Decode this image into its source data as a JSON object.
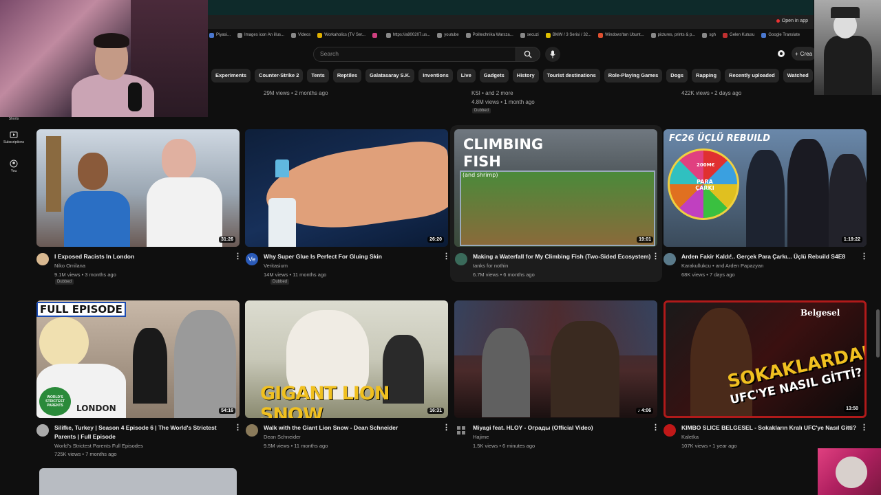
{
  "browser": {
    "open_in_app": "Open in app"
  },
  "bookmarks": [
    {
      "label": "Piyasi...",
      "color": "#4a78d0"
    },
    {
      "label": "Images icon An illus...",
      "color": "#888"
    },
    {
      "label": "Videos",
      "color": "#888"
    },
    {
      "label": "Workaholics (TV Ser...",
      "color": "#e0b000"
    },
    {
      "label": "",
      "color": "#d04080"
    },
    {
      "label": "https://a800207.us...",
      "color": "#888"
    },
    {
      "label": "youtube",
      "color": "#888"
    },
    {
      "label": "Politechnika Warsza...",
      "color": "#888"
    },
    {
      "label": "secuzi",
      "color": "#888"
    },
    {
      "label": "BMW / 3 Serisi / 32...",
      "color": "#e0c000"
    },
    {
      "label": "Windows'tan Ubunt...",
      "color": "#e05030"
    },
    {
      "label": "pictures, prints & p...",
      "color": "#888"
    },
    {
      "label": "sgh",
      "color": "#888"
    },
    {
      "label": "Gelen Kutusu",
      "color": "#c03030"
    },
    {
      "label": "Google Translate",
      "color": "#4a78d0"
    }
  ],
  "search": {
    "placeholder": "Search"
  },
  "header": {
    "create_label": "Crea"
  },
  "chips": [
    "Experiments",
    "Counter-Strike 2",
    "Tents",
    "Reptiles",
    "Galatasaray S.K.",
    "Inventions",
    "Live",
    "Gadgets",
    "History",
    "Tourist destinations",
    "Role-Playing Games",
    "Dogs",
    "Rapping",
    "Recently uploaded",
    "Watched"
  ],
  "sidebar": {
    "shorts_label": "Shorts",
    "subscriptions_label": "Subscriptions",
    "you_label": "You"
  },
  "row0": [
    {
      "meta": "29M views • 2 months ago"
    },
    {
      "meta": "KSI • and 2 more",
      "meta2": "4.8M views • 1 month ago",
      "badge": "Dubbed"
    },
    {
      "meta": "422K views • 2 days ago"
    }
  ],
  "videos": [
    {
      "title": "I Exposed Racists In London",
      "channel": "Niko Omilana",
      "stats": "9.1M views • 3 months ago",
      "duration": "31:26",
      "badge": "Dubbed"
    },
    {
      "title": "Why Super Glue Is Perfect For Gluing Skin",
      "channel": "Veritasium",
      "stats": "14M views • 11 months ago",
      "duration": "26:20",
      "badge": "Dubbed",
      "avatar_text": "Ve"
    },
    {
      "title": "Making a Waterfall for My Climbing Fish (Two-Sided Ecosystem)",
      "channel": "tanks for nothin",
      "stats": "6.7M views • 6 months ago",
      "duration": "19:01",
      "overlay1": "CLIMBING",
      "overlay2": "FISH",
      "overlay3": "(and shrimp)"
    },
    {
      "title": "Arden Fakir Kaldı!.. Gerçek Para Çarkı... Üçlü Rebuild S4E8",
      "channel": "Karakullukcu • and Arden Papazyan",
      "stats": "68K views • 7 days ago",
      "duration": "1:19:22",
      "overlay1": "FC26 ÜÇLÜ REBUILD",
      "wheel_center": "PARA ÇARKI",
      "wheel_label": "200M€"
    },
    {
      "title": "Silifke, Turkey | Season 4 Episode 6 | The World's Strictest",
      "title2": "Parents | Full Episode",
      "channel": "World's Strictest Parents Full Episodes",
      "stats": "725K views • 7 months ago",
      "duration": "54:16",
      "overlay1": "FULL EPISODE",
      "overlay2": "WORLD'S STRICTEST PARENTS",
      "shirt": "LONDON"
    },
    {
      "title": "Walk with the Giant Lion Snow - Dean Schneider",
      "channel": "Dean Schneider",
      "stats": "9.5M views • 11 months ago",
      "duration": "16:31",
      "overlay1": "GIGANT LION SNOW"
    },
    {
      "title": "Miyagi feat. HLOY - Ограды (Official Video)",
      "channel": "Hajime",
      "stats": "1.5K views • 6 minutes ago",
      "duration": "4:06"
    },
    {
      "title": "KIMBO SLICE BELGESEL - Sokakların Kralı UFC'ye Nasıl Gitti?",
      "channel": "Kaletka",
      "stats": "107K views • 1 year ago",
      "duration": "13:50",
      "overlay1": "Belgesel",
      "overlay2": "SOKAKLARDAN",
      "overlay3": "UFC'YE NASIL GİTTİ?"
    }
  ]
}
